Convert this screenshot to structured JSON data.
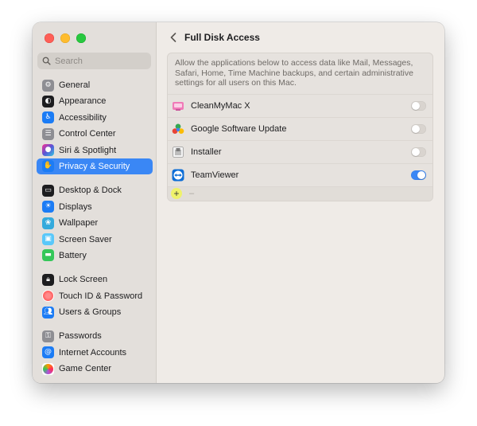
{
  "sidebar": {
    "search_placeholder": "Search",
    "items": [
      {
        "label": "General",
        "icon": "gear-icon",
        "color": "#8e8e93"
      },
      {
        "label": "Appearance",
        "icon": "appearance-icon",
        "color": "#1d1d1f"
      },
      {
        "label": "Accessibility",
        "icon": "accessibility-icon",
        "color": "#1c7cf5"
      },
      {
        "label": "Control Center",
        "icon": "control-center-icon",
        "color": "#8e8e93"
      },
      {
        "label": "Siri & Spotlight",
        "icon": "siri-icon",
        "color": "#5856d6"
      },
      {
        "label": "Privacy & Security",
        "icon": "hand-icon",
        "color": "#1c7cf5",
        "active": true
      },
      {
        "label": "Desktop & Dock",
        "icon": "dock-icon",
        "color": "#1d1d1f"
      },
      {
        "label": "Displays",
        "icon": "sun-icon",
        "color": "#1c7cf5"
      },
      {
        "label": "Wallpaper",
        "icon": "wallpaper-icon",
        "color": "#34aadc"
      },
      {
        "label": "Screen Saver",
        "icon": "screensaver-icon",
        "color": "#5ac8fa"
      },
      {
        "label": "Battery",
        "icon": "battery-icon",
        "color": "#34c759"
      },
      {
        "label": "Lock Screen",
        "icon": "lock-icon",
        "color": "#1d1d1f"
      },
      {
        "label": "Touch ID & Password",
        "icon": "fingerprint-icon",
        "color": "#ff6b6b"
      },
      {
        "label": "Users & Groups",
        "icon": "users-icon",
        "color": "#1c7cf5"
      },
      {
        "label": "Passwords",
        "icon": "key-icon",
        "color": "#8e8e93"
      },
      {
        "label": "Internet Accounts",
        "icon": "at-icon",
        "color": "#1c7cf5"
      },
      {
        "label": "Game Center",
        "icon": "game-center-icon",
        "color": "#ff9500"
      }
    ]
  },
  "main": {
    "title": "Full Disk Access",
    "description": "Allow the applications below to access data like Mail, Messages, Safari, Home, Time Machine backups, and certain administrative settings for all users on this Mac.",
    "apps": [
      {
        "name": "CleanMyMac X",
        "icon": "cleanmymac-icon",
        "enabled": false
      },
      {
        "name": "Google Software Update",
        "icon": "google-update-icon",
        "enabled": false
      },
      {
        "name": "Installer",
        "icon": "installer-icon",
        "enabled": false
      },
      {
        "name": "TeamViewer",
        "icon": "teamviewer-icon",
        "enabled": true
      }
    ],
    "add_label": "+",
    "remove_label": "–"
  },
  "colors": {
    "accent": "#3a87f5",
    "highlight": "#eff26b"
  }
}
